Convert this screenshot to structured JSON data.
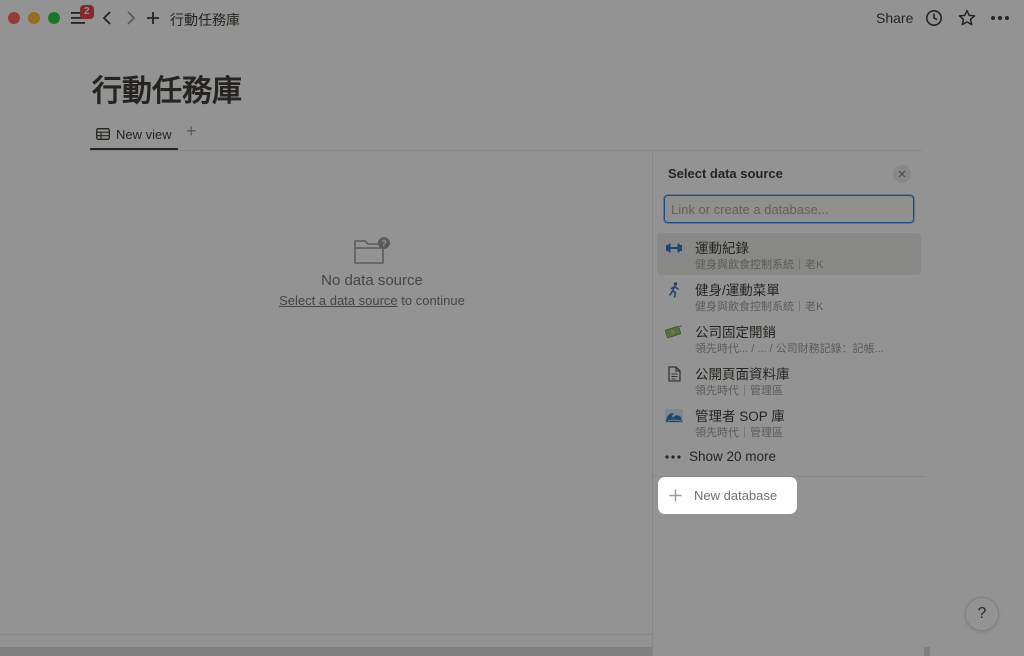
{
  "titlebar": {
    "notification_count": "2",
    "breadcrumb": "行動任務庫",
    "share_label": "Share"
  },
  "page": {
    "title": "行動任務庫",
    "view_tab_label": "New view"
  },
  "empty_state": {
    "title": "No data source",
    "link_text": "Select a data source",
    "suffix_text": " to continue"
  },
  "panel": {
    "title": "Select data source",
    "search_placeholder": "Link or create a database...",
    "items": [
      {
        "name": "運動紀錄",
        "path": "健身與飲食控制系統｜老K",
        "icon": "dumbbell-icon"
      },
      {
        "name": "健身/運動菜單",
        "path": "健身與飲食控制系統｜老K",
        "icon": "running-person-icon"
      },
      {
        "name": "公司固定開銷",
        "path": "領先時代...    / ... / 公司財務記錄：記帳...",
        "icon": "money-icon"
      },
      {
        "name": "公開頁面資料庫",
        "path": "領先時代｜管理區",
        "icon": "document-icon"
      },
      {
        "name": "管理者 SOP 庫",
        "path": "領先時代｜管理區",
        "icon": "wave-icon"
      }
    ],
    "show_more_label": "Show 20 more",
    "new_database_label": "New database"
  },
  "help_label": "?",
  "colors": {
    "badge": "#e03e3e",
    "focus": "#2383e2",
    "text": "#37352f"
  }
}
